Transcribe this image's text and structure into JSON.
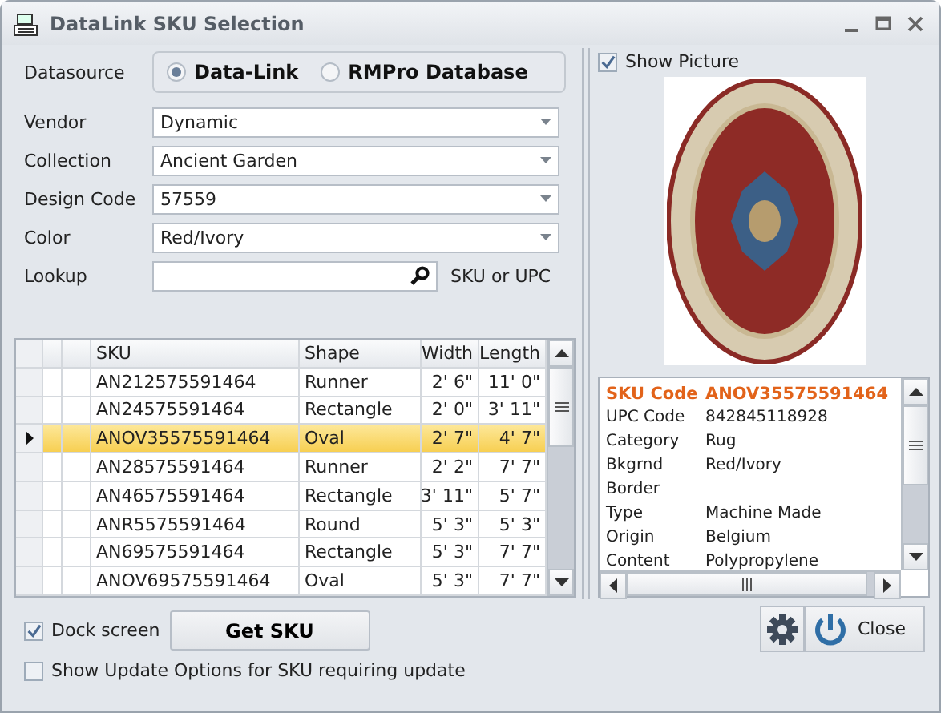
{
  "window": {
    "title": "DataLink SKU Selection"
  },
  "datasource": {
    "label": "Datasource",
    "options": [
      {
        "label": "Data-Link",
        "selected": true
      },
      {
        "label": "RMPro Database",
        "selected": false
      }
    ]
  },
  "fields": [
    {
      "kind": "dropdown",
      "label": "Vendor",
      "value": "Dynamic"
    },
    {
      "kind": "dropdown",
      "label": "Collection",
      "value": "Ancient Garden"
    },
    {
      "kind": "dropdown",
      "label": "Design Code",
      "value": "57559"
    },
    {
      "kind": "dropdown",
      "label": "Color",
      "value": "Red/Ivory"
    },
    {
      "kind": "search",
      "label": "Lookup",
      "hint": "SKU or UPC"
    }
  ],
  "grid": {
    "columns": [
      "SKU",
      "Shape",
      "Width",
      "Length"
    ],
    "rows": [
      {
        "sku": "AN212575591464",
        "shape": "Runner",
        "width": "2' 6\"",
        "length": "11' 0\"",
        "selected": false
      },
      {
        "sku": "AN24575591464",
        "shape": "Rectangle",
        "width": "2' 0\"",
        "length": "3' 11\"",
        "selected": false
      },
      {
        "sku": "ANOV35575591464",
        "shape": "Oval",
        "width": "2' 7\"",
        "length": "4' 7\"",
        "selected": true
      },
      {
        "sku": "AN28575591464",
        "shape": "Runner",
        "width": "2' 2\"",
        "length": "7' 7\"",
        "selected": false
      },
      {
        "sku": "AN46575591464",
        "shape": "Rectangle",
        "width": "3' 11\"",
        "length": "5' 7\"",
        "selected": false
      },
      {
        "sku": "ANR5575591464",
        "shape": "Round",
        "width": "5' 3\"",
        "length": "5' 3\"",
        "selected": false
      },
      {
        "sku": "AN69575591464",
        "shape": "Rectangle",
        "width": "5' 3\"",
        "length": "7' 7\"",
        "selected": false
      },
      {
        "sku": "ANOV69575591464",
        "shape": "Oval",
        "width": "5' 3\"",
        "length": "7' 7\"",
        "selected": false
      }
    ]
  },
  "dock_screen": {
    "label": "Dock screen",
    "checked": true
  },
  "get_sku_button": {
    "label": "Get SKU"
  },
  "show_update": {
    "label": "Show Update Options for SKU requiring update",
    "checked": false
  },
  "show_picture": {
    "label": "Show Picture",
    "checked": true
  },
  "details": {
    "rows": [
      {
        "label": "SKU Code",
        "value": "ANOV35575591464",
        "emphasis": true
      },
      {
        "label": "UPC Code",
        "value": "842845118928",
        "emphasis": false
      },
      {
        "label": "Category",
        "value": "Rug",
        "emphasis": false
      },
      {
        "label": "Bkgrnd",
        "value": "Red/Ivory",
        "emphasis": false
      },
      {
        "label": "Border",
        "emphasis": false
      },
      {
        "label": "Type",
        "value": "Machine Made",
        "emphasis": false
      },
      {
        "label": "Origin",
        "value": "Belgium",
        "emphasis": false
      },
      {
        "label": "Content",
        "value": "Polypropylene",
        "emphasis": false
      }
    ]
  },
  "close_button": {
    "label": "Close"
  }
}
